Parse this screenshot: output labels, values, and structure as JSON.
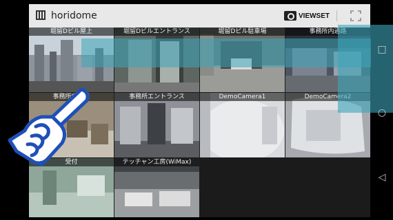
{
  "app": {
    "title": "horidome",
    "viewset_label": "VIEWSET"
  },
  "icons": {
    "app": "grid-view-icon",
    "camera": "camera-icon",
    "fullscreen": "fullscreen-icon",
    "nav_recent": "recent-apps-icon",
    "nav_home": "home-icon",
    "nav_back": "back-icon"
  },
  "cameras": [
    {
      "label": "堀留Dビル屋上"
    },
    {
      "label": "堀留Dビルエントランス"
    },
    {
      "label": "堀留Dビル駐車場"
    },
    {
      "label": "事務所内通路"
    },
    {
      "label": "事務所内全景"
    },
    {
      "label": "事務所エントランス"
    },
    {
      "label": "DemoCamera1"
    },
    {
      "label": "DemoCamera2"
    },
    {
      "label": "受付"
    },
    {
      "label": "テッチャン工房(WiMax)"
    }
  ],
  "nav": {
    "recent_glyph": "□",
    "home_glyph": "○",
    "back_glyph": "◁"
  },
  "colors": {
    "overlay": "#3ca5b9",
    "appbar": "#e8e8e8"
  }
}
